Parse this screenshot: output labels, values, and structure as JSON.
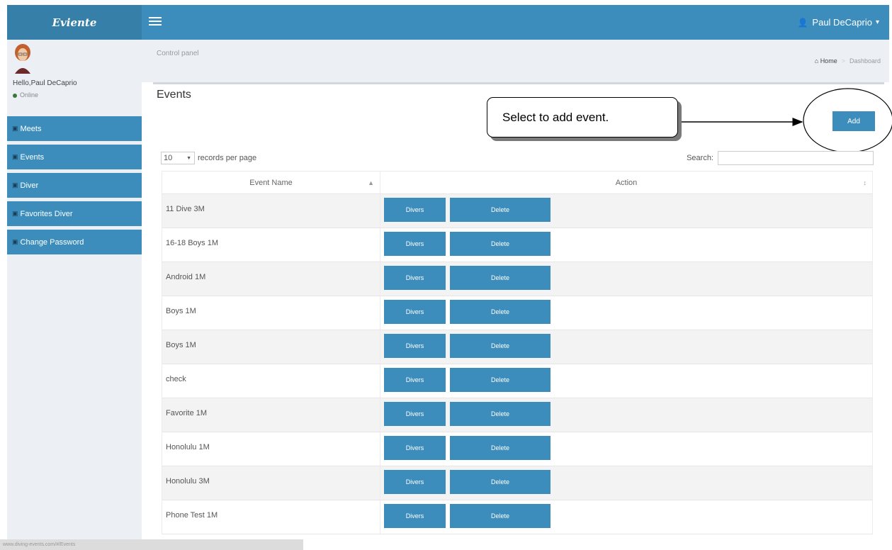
{
  "topbar": {
    "logo": "Eviente",
    "user_name": "Paul DeCaprio"
  },
  "sidebar": {
    "hello": "Hello,Paul DeCaprio",
    "status": "Online",
    "items": [
      {
        "label": "Meets",
        "icon": "group-icon"
      },
      {
        "label": "Events",
        "icon": "group-icon"
      },
      {
        "label": "Diver",
        "icon": "group-icon"
      },
      {
        "label": "Favorites Diver",
        "icon": "group-icon"
      },
      {
        "label": "Change Password",
        "icon": "group-icon"
      }
    ]
  },
  "header": {
    "title": "Control panel",
    "breadcrumb_home": "Home",
    "breadcrumb_current": "Dashboard"
  },
  "main": {
    "title": "Events",
    "add_label": "Add",
    "callout": "Select to add event.",
    "length": {
      "value": "10",
      "label": "records per page"
    },
    "search_label": "Search:",
    "columns": [
      "Event Name",
      "Action"
    ],
    "row_buttons": [
      "Divers",
      "Delete"
    ],
    "rows": [
      {
        "name": "11 Dive 3M"
      },
      {
        "name": "16-18 Boys 1M"
      },
      {
        "name": "Android 1M"
      },
      {
        "name": "Boys 1M"
      },
      {
        "name": "Boys 1M"
      },
      {
        "name": "check"
      },
      {
        "name": "Favorite 1M"
      },
      {
        "name": "Honolulu 1M"
      },
      {
        "name": "Honolulu 3M"
      },
      {
        "name": "Phone Test 1M"
      }
    ]
  },
  "statusbar": "www.diving-events.com/#/Events",
  "colors": {
    "primary": "#3c8dbc",
    "primary_dark": "#367fa9",
    "sidebar_bg": "#ecf0f5"
  }
}
